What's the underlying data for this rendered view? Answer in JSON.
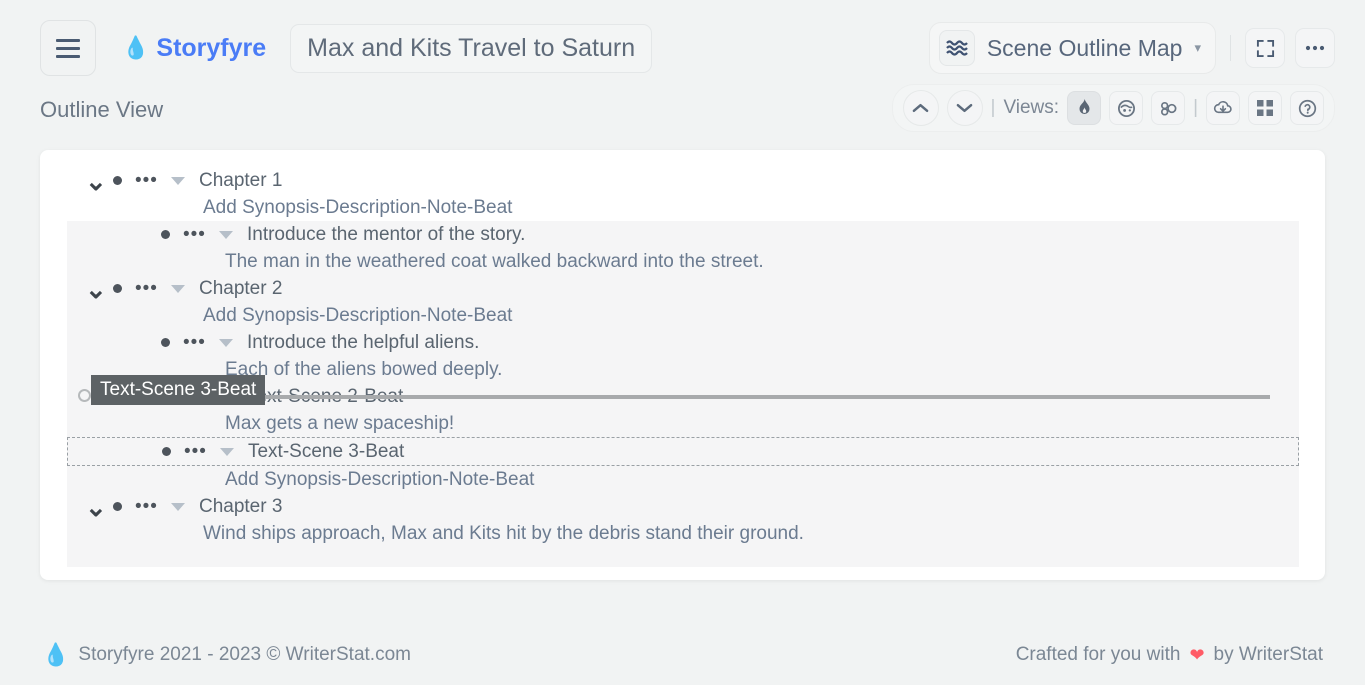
{
  "header": {
    "menu_icon": "hamburger-icon",
    "brand_name": "Storyfyre",
    "brand_icon": "flame-icon",
    "brand_color": "#4a7cf6",
    "project_title": "Max and Kits Travel to Saturn",
    "map_select": {
      "icon": "waves-icon",
      "label": "Scene Outline Map",
      "caret": "chevron-down-icon"
    },
    "fullscreen_icon": "expand-icon",
    "more_icon": "ellipsis-icon"
  },
  "subheader": {
    "page_title": "Outline View",
    "views_bar": {
      "up_icon": "chevron-up-icon",
      "down_icon": "chevron-down-icon",
      "separator": "|",
      "label": "Views:",
      "view_buttons": [
        {
          "name": "flame-icon",
          "active": true
        },
        {
          "name": "mask-face-icon",
          "active": false
        },
        {
          "name": "molecule-icon",
          "active": false
        }
      ],
      "tool_buttons": [
        {
          "name": "cloud-download-icon"
        },
        {
          "name": "grid-icon"
        },
        {
          "name": "help-circle-icon"
        }
      ]
    }
  },
  "outline": {
    "rows": [
      {
        "type": "node",
        "chevron": true,
        "highlight": true,
        "indent": 0,
        "text": "Chapter 1"
      },
      {
        "type": "text",
        "highlight": true,
        "indent": 118,
        "text": "Add Synopsis-Description-Note-Beat"
      },
      {
        "type": "node",
        "chevron": false,
        "highlight": false,
        "indent": 48,
        "text": "Introduce the mentor of the story."
      },
      {
        "type": "text",
        "highlight": false,
        "indent": 140,
        "text": "The man in the weathered coat walked backward into the street."
      },
      {
        "type": "node",
        "chevron": true,
        "highlight": false,
        "indent": 0,
        "text": "Chapter 2"
      },
      {
        "type": "text",
        "highlight": false,
        "indent": 118,
        "text": "Add Synopsis-Description-Note-Beat"
      },
      {
        "type": "node",
        "chevron": false,
        "highlight": false,
        "indent": 48,
        "text": "Introduce the helpful aliens."
      },
      {
        "type": "text",
        "highlight": false,
        "indent": 140,
        "text": "Each of the aliens bowed deeply."
      },
      {
        "type": "node",
        "chevron": false,
        "highlight": false,
        "indent": 48,
        "text": "Text-Scene 2-Beat"
      },
      {
        "type": "text",
        "highlight": false,
        "indent": 140,
        "text": "Max gets a new spaceship!"
      },
      {
        "type": "node",
        "chevron": false,
        "highlight": false,
        "indent": 48,
        "dashed": true,
        "text": "Text-Scene 3-Beat"
      },
      {
        "type": "text",
        "highlight": false,
        "indent": 140,
        "text": "Add Synopsis-Description-Note-Beat"
      },
      {
        "type": "node",
        "chevron": true,
        "highlight": false,
        "indent": 0,
        "text": "Chapter 3"
      },
      {
        "type": "text",
        "highlight": false,
        "indent": 118,
        "text": "Wind ships approach, Max and Kits hit by the debris stand their ground."
      }
    ],
    "drag": {
      "chip_label": "Text-Scene 3-Beat",
      "chip_bg": "#5d6265",
      "drop_line_color": "#a8aaac"
    },
    "row_icons": {
      "chevron": "chevron-down-icon",
      "bullet": "bullet-dot-icon",
      "ellipsis": "ellipsis-icon",
      "triangle": "triangle-down-icon"
    }
  },
  "footer": {
    "brand_icon": "flame-icon",
    "copyright": "Storyfyre 2021 - 2023 ©  WriterStat.com",
    "crafted_text": "Crafted for you with",
    "heart_icon": "heart-icon",
    "heart_color": "#ff5b66",
    "by_text": "by WriterStat"
  }
}
